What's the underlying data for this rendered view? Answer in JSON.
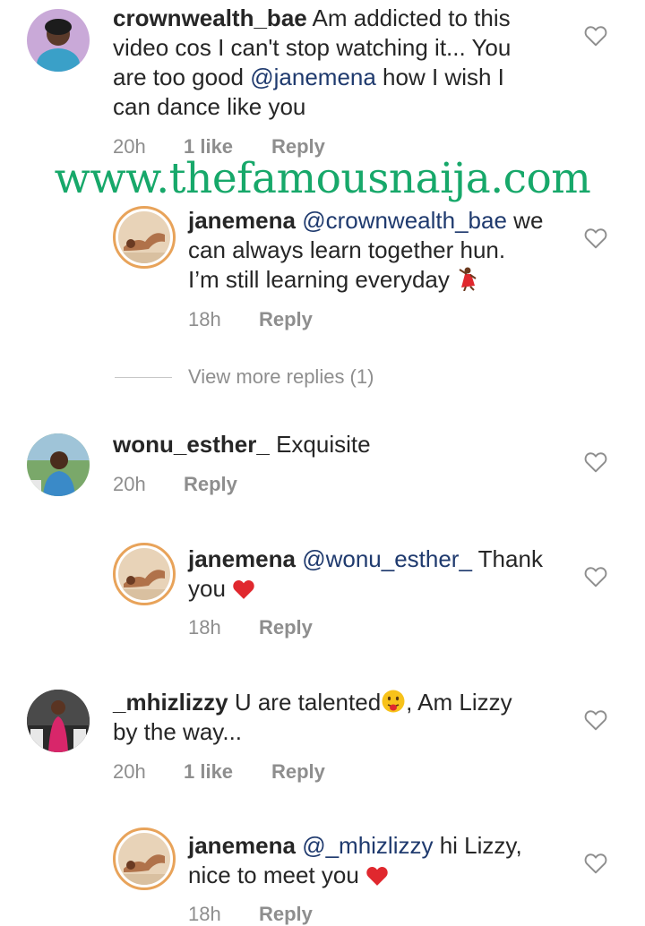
{
  "comments": [
    {
      "username": "crownwealth_bae",
      "text_line1": "Am addicted to this",
      "text_line2": "video cos I can't stop watching it... You",
      "text_line3_pre": "are too good ",
      "mention": "@janemena",
      "text_line3_post": " how I wish I",
      "text_line4": "can dance like you",
      "time": "20h",
      "likes": "1 like",
      "reply": "Reply"
    },
    {
      "username": "janemena",
      "mention": "@crownwealth_bae",
      "text_line1_post": " we",
      "text_line2": "can always learn together hun.",
      "text_line3": "I’m still learning everyday",
      "emoji": "dancer",
      "time": "18h",
      "reply": "Reply"
    },
    {
      "username": "wonu_esther_",
      "text": "Exquisite",
      "time": "20h",
      "reply": "Reply"
    },
    {
      "username": "janemena",
      "mention": "@wonu_esther_",
      "text_line1_post": " Thank",
      "text_line2": "you",
      "emoji": "red-heart",
      "time": "18h",
      "reply": "Reply"
    },
    {
      "username": "_mhizlizzy",
      "text_line1": "U are talented",
      "emoji": "face-with-tongue",
      "text_line1_post": ", Am Lizzy",
      "text_line2": "by the way...",
      "time": "20h",
      "likes": "1 like",
      "reply": "Reply"
    },
    {
      "username": "janemena",
      "mention": "@_mhizlizzy",
      "text_line1_post": " hi Lizzy,",
      "text_line2": "nice to meet you",
      "emoji": "red-heart",
      "time": "18h",
      "reply": "Reply"
    }
  ],
  "view_more_replies": "View more replies (1)",
  "watermark": "www.thefamousnaija.com",
  "icons": {
    "like": "heart-outline-icon"
  },
  "colors": {
    "text": "#262626",
    "meta": "#8e8e8e",
    "mention": "#1f3a6e",
    "watermark": "#17a86a",
    "heart_red": "#e0282e"
  }
}
